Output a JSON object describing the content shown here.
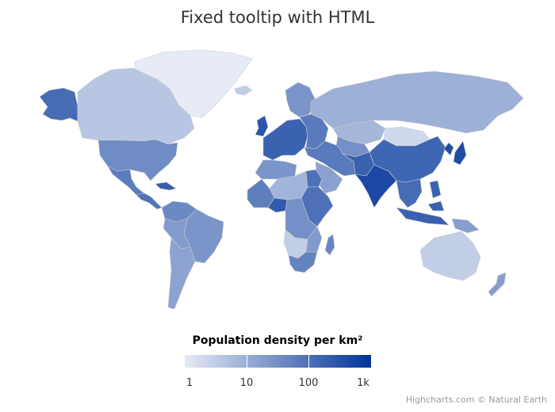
{
  "title": "Fixed tooltip with HTML",
  "legend": {
    "title": "Population density per km²",
    "ticks": [
      "1",
      "10",
      "100",
      "1k"
    ],
    "min_color": "#e6ebf5",
    "max_color": "#003399",
    "scale": "logarithmic"
  },
  "credits": "Highcharts.com © Natural Earth",
  "colors": {
    "border": "#cccccc",
    "background": "#ffffff"
  },
  "chart_data": {
    "type": "heatmap",
    "subtype": "choropleth-world-map",
    "colorAxis": {
      "type": "logarithmic",
      "min": 1,
      "max": 1000
    },
    "regions": [
      {
        "name": "Greenland",
        "value": 0.1
      },
      {
        "name": "Canada",
        "value": 4
      },
      {
        "name": "Alaska",
        "value": 120
      },
      {
        "name": "United States",
        "value": 35
      },
      {
        "name": "Mexico",
        "value": 65
      },
      {
        "name": "Central America",
        "value": 90
      },
      {
        "name": "Caribbean",
        "value": 200
      },
      {
        "name": "Colombia & Venezuela",
        "value": 40
      },
      {
        "name": "Brazil",
        "value": 25
      },
      {
        "name": "Peru & Bolivia",
        "value": 20
      },
      {
        "name": "Argentina & Chile",
        "value": 15
      },
      {
        "name": "Scandinavia",
        "value": 25
      },
      {
        "name": "Iceland",
        "value": 3
      },
      {
        "name": "United Kingdom",
        "value": 280
      },
      {
        "name": "Western & Central Europe",
        "value": 170
      },
      {
        "name": "Eastern Europe",
        "value": 70
      },
      {
        "name": "Russia",
        "value": 9
      },
      {
        "name": "Kazakhstan",
        "value": 7
      },
      {
        "name": "Mongolia",
        "value": 2
      },
      {
        "name": "Central Asia",
        "value": 30
      },
      {
        "name": "Middle East",
        "value": 70
      },
      {
        "name": "Saudi Arabia",
        "value": 16
      },
      {
        "name": "North Africa (west)",
        "value": 25
      },
      {
        "name": "Sahara",
        "value": 8
      },
      {
        "name": "Egypt",
        "value": 100
      },
      {
        "name": "West Africa",
        "value": 60
      },
      {
        "name": "Nigeria",
        "value": 220
      },
      {
        "name": "Central Africa",
        "value": 30
      },
      {
        "name": "East Africa",
        "value": 100
      },
      {
        "name": "Southern Africa",
        "value": 20
      },
      {
        "name": "Botswana & Namibia",
        "value": 3
      },
      {
        "name": "South Africa",
        "value": 50
      },
      {
        "name": "Madagascar",
        "value": 45
      },
      {
        "name": "India",
        "value": 450
      },
      {
        "name": "Pakistan & Afghanistan",
        "value": 180
      },
      {
        "name": "China",
        "value": 150
      },
      {
        "name": "Southeast Asia",
        "value": 120
      },
      {
        "name": "Korea & Japan",
        "value": 400
      },
      {
        "name": "Indonesia & Philippines",
        "value": 180
      },
      {
        "name": "Papua New Guinea",
        "value": 18
      },
      {
        "name": "Australia",
        "value": 3
      },
      {
        "name": "New Zealand",
        "value": 18
      }
    ]
  }
}
